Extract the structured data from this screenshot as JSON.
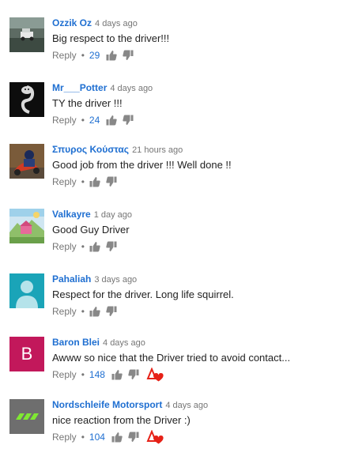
{
  "comments": [
    {
      "author": "Ozzik Oz",
      "time": "4 days ago",
      "text": "Big respect to the driver!!!",
      "reply_label": "Reply",
      "separator": "•",
      "likes": "29"
    },
    {
      "author": "Mr___Potter",
      "time": "4 days ago",
      "text": "TY the driver !!!",
      "reply_label": "Reply",
      "separator": "•",
      "likes": "24"
    },
    {
      "author": "Σπυρος Κούστας",
      "time": "21 hours ago",
      "text": "Good job from the driver !!! Well done !!",
      "reply_label": "Reply",
      "separator": "•",
      "likes": ""
    },
    {
      "author": "Valkayre",
      "time": "1 day ago",
      "text": "Good Guy Driver",
      "reply_label": "Reply",
      "separator": "•",
      "likes": ""
    },
    {
      "author": "Pahaliah",
      "time": "3 days ago",
      "text": "Respect for the driver. Long life squirrel.",
      "reply_label": "Reply",
      "separator": "•",
      "likes": ""
    },
    {
      "author": "Baron Blei",
      "time": "4 days ago",
      "text": "Awww so nice that the Driver tried to avoid contact...",
      "reply_label": "Reply",
      "separator": "•",
      "likes": "148",
      "avatar_letter": "B",
      "avatar_color": "#c2185b",
      "creator_heart": true
    },
    {
      "author": "Nordschleife Motorsport",
      "time": "4 days ago",
      "text": "nice reaction from the Driver :)",
      "reply_label": "Reply",
      "separator": "•",
      "likes": "104",
      "creator_heart": true
    }
  ],
  "colors": {
    "author": "#1f6fd1",
    "likes": "#1f6fd1",
    "meta": "#767676",
    "heart": "#e62117",
    "pahaliah_avatar_bg": "#1aa4b8"
  }
}
